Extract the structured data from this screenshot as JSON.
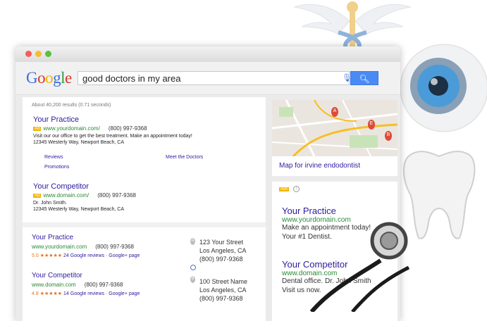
{
  "search": {
    "logo": "Google",
    "query": "good doctors in my area"
  },
  "results": {
    "stats": "About 40,200 results (0.71 seconds)",
    "ad1": {
      "badge": "Ad",
      "title": "Your Practice",
      "url": "www.yourdomain.com/",
      "phone": "(800) 997-9368",
      "desc": "Visit our our office to get the best treatment. Make an appointment today!",
      "address": "12345 Westerly Way, Newport Beach, CA",
      "links": [
        "Reviews",
        "Meet the Doctors",
        "Promotions"
      ]
    },
    "ad2": {
      "badge": "Ad",
      "title": "Your Competitor",
      "url": "www.domain.com/",
      "phone": "(800) 997-9368",
      "desc": "Dr. John Smith.",
      "address": "12345 Westerly Way, Newport Beach, CA"
    },
    "local": [
      {
        "title": "Your Practice",
        "url": "www.yourdomain.com",
        "phone": "(800) 997-9368",
        "rating": "5.0",
        "stars": "★★★★★",
        "reviews": "24 Google reviews",
        "gplus": "Google+ page",
        "pin": "A",
        "street": "123 Your Street",
        "city": "Los Angeles, CA",
        "addr_phone": "(800) 997-9368"
      },
      {
        "title": "Your Competitor",
        "url": "www.domain.com",
        "phone": "(800) 997-9368",
        "rating": "4.8",
        "stars": "★★★★★",
        "reviews": "14 Google reviews",
        "gplus": "Google+ page",
        "pin": "B",
        "street": "100 Street Name",
        "city": "Los Angeles, CA",
        "addr_phone": "(800) 997-9368"
      }
    ]
  },
  "sidebar": {
    "map_caption": "Map for irvine endodontist",
    "map_pins": [
      "A",
      "E",
      "B"
    ],
    "ads_label": "Ads",
    "ad1": {
      "title": "Your Practice",
      "url": "www.yourdomain.com",
      "line1": "Make an appointment today!",
      "line2": "Your #1 Dentist."
    },
    "ad2": {
      "title": "Your Competitor",
      "url": "www.domain.com",
      "line1": "Dental office. Dr. John Smith",
      "line2": "Visit us now."
    }
  },
  "colors": {
    "link": "#2c1c9e",
    "url": "#2a8a37",
    "ad_badge": "#f1b505",
    "search_button": "#4a8af4"
  }
}
